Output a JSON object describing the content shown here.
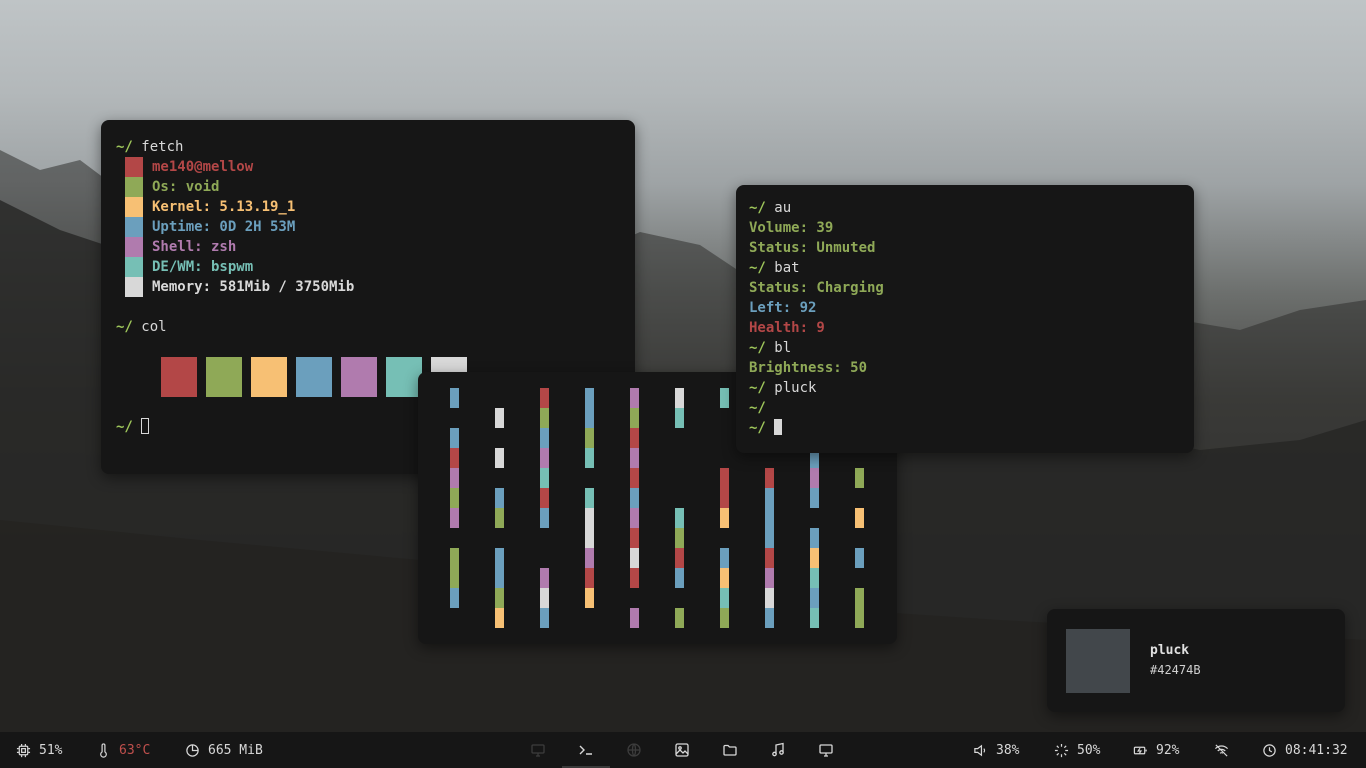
{
  "colors": {
    "red": "#b34747",
    "green": "#8fa957",
    "yellow": "#f7c074",
    "blue": "#6b9fbd",
    "magenta": "#b07bae",
    "cyan": "#76bfb5",
    "white": "#d8d8d8",
    "prompt": "#9dc55a",
    "terminal_bg": "#161616",
    "bar_bg": "#161616"
  },
  "term1": {
    "cmd1": "fetch",
    "prompt": "~/",
    "info": [
      {
        "label": "me140@mellow",
        "color": "#b34747"
      },
      {
        "label": "Os: void",
        "color": "#8fa957"
      },
      {
        "label": "Kernel: 5.13.19_1",
        "color": "#f7c074"
      },
      {
        "label": "Uptime: 0D 2H 53M",
        "color": "#6b9fbd"
      },
      {
        "label": "Shell: zsh",
        "color": "#b07bae"
      },
      {
        "label": "DE/WM: bspwm",
        "color": "#76bfb5"
      },
      {
        "label": "Memory: 581Mib / 3750Mib",
        "color": "#d8d8d8"
      }
    ],
    "cmd2": "col"
  },
  "term2": {
    "lines": [
      {
        "prompt": "~/",
        "text": "au"
      },
      {
        "text": "Volume: 39",
        "color": "#8fa957"
      },
      {
        "text": "Status: Unmuted",
        "color": "#8fa957"
      },
      {
        "prompt": "~/",
        "text": "bat"
      },
      {
        "text": "Status: Charging",
        "color": "#8fa957"
      },
      {
        "text": "Left: 92",
        "color": "#6b9fbd"
      },
      {
        "text": "Health: 9",
        "color": "#b34747"
      },
      {
        "prompt": "~/",
        "text": "bl"
      },
      {
        "text": "Brightness: 50",
        "color": "#8fa957"
      },
      {
        "prompt": "~/",
        "text": "pluck"
      },
      {
        "prompt": "~/",
        "text": ""
      },
      {
        "prompt": "~/",
        "text": ""
      }
    ]
  },
  "notification": {
    "title": "pluck",
    "hex": "#42474B",
    "swatch_color": "#42474b"
  },
  "bar": {
    "cpu": "51%",
    "temp": "63°C",
    "temp_color": "#c0504d",
    "memory": "665 MiB",
    "volume": "38%",
    "brightness": "50%",
    "battery": "92%",
    "clock": "08:41:32",
    "workspaces": [
      "desktop-icon",
      "terminal-icon",
      "globe-icon",
      "image-icon",
      "folder-icon",
      "music-icon",
      "monitor-icon"
    ]
  }
}
